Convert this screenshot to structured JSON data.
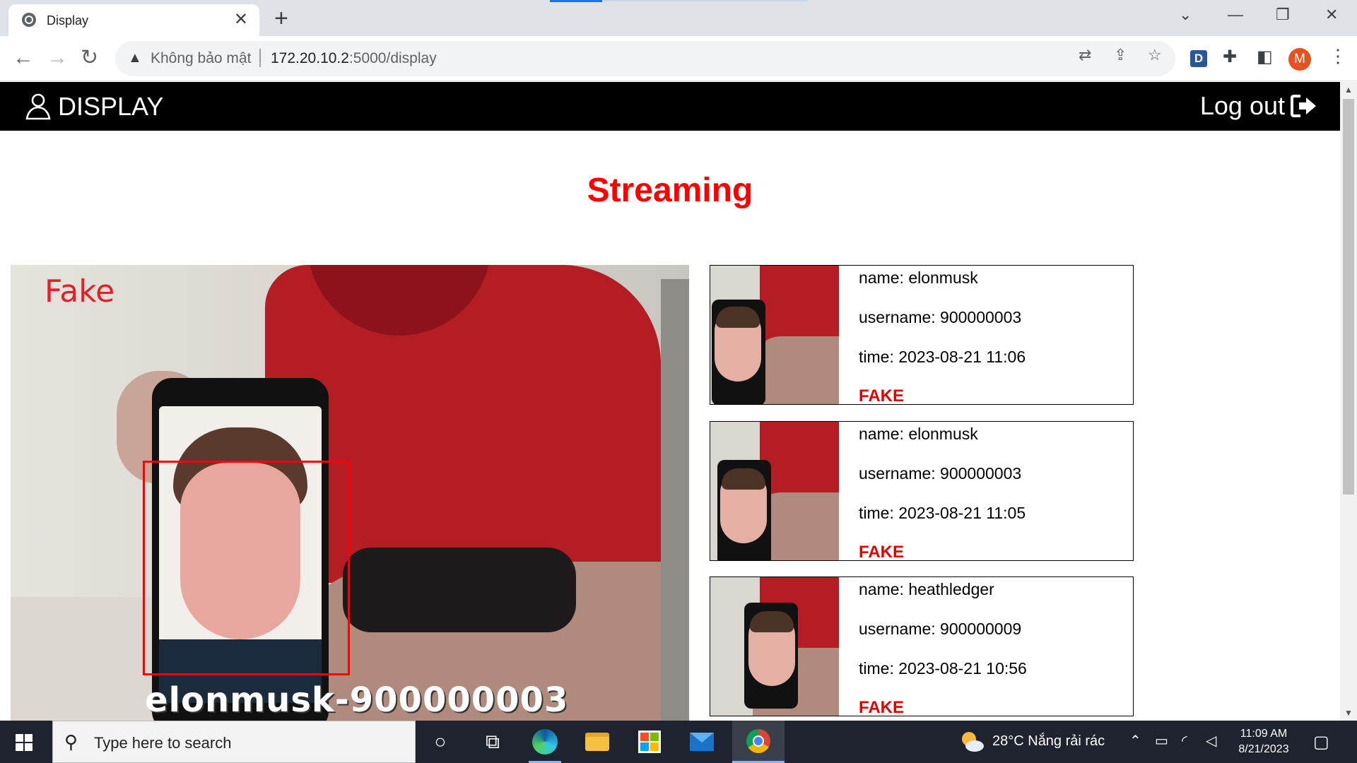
{
  "browser": {
    "tab_title": "Display",
    "tab_close": "✕",
    "new_tab": "+",
    "security_label": "Không bảo mật",
    "url_host": "172.20.10.2",
    "url_path": ":5000/display",
    "profile_initial": "M",
    "extension_letter": "D"
  },
  "app": {
    "brand": "DISPLAY",
    "logout_label": "Log out",
    "heading": "Streaming"
  },
  "stream": {
    "overlay_status": "Fake",
    "overlay_identity": "elonmusk-900000003"
  },
  "detections": [
    {
      "name": "name: elonmusk",
      "username": "username: 900000003",
      "time": "time: 2023-08-21 11:06",
      "status": "FAKE"
    },
    {
      "name": "name: elonmusk",
      "username": "username: 900000003",
      "time": "time: 2023-08-21 11:05",
      "status": "FAKE"
    },
    {
      "name": "name: heathledger",
      "username": "username: 900000009",
      "time": "time: 2023-08-21 10:56",
      "status": "FAKE"
    }
  ],
  "taskbar": {
    "search_placeholder": "Type here to search",
    "weather": "28°C  Nắng rải rác",
    "time": "11:09 AM",
    "date": "8/21/2023",
    "apps": [
      "cortana-icon",
      "task-view-icon",
      "edge-icon",
      "file-explorer-icon",
      "store-icon",
      "mail-icon",
      "chrome-icon"
    ]
  },
  "colors": {
    "accent_red": "#ff0000",
    "appbar_bg": "#000000",
    "status_fake": "#e30000"
  }
}
